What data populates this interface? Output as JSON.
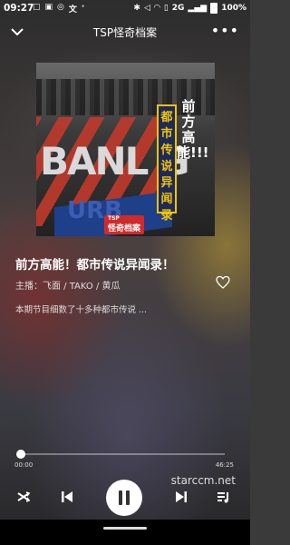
{
  "status_bar": {
    "time": "09:27",
    "battery": "100%",
    "network": "2G"
  },
  "header": {
    "title": "TSP怪奇档案"
  },
  "cover": {
    "side_text": "前方高能!!!",
    "vertical_label": "都市传说异闻录",
    "banner_text": "BANL G",
    "urban_text": "URB",
    "logo_top": "TSP",
    "logo_main": "怪奇档案"
  },
  "episode": {
    "title": "前方高能！都市传说异闻录！",
    "hosts": "主播：飞面 / TAKO / 黄瓜",
    "description": "本期节目细数了十多种都市传说 ..."
  },
  "player": {
    "current_time": "00:00",
    "total_time": "46:25",
    "progress": 0
  },
  "watermark": "starccm.net",
  "colors": {
    "accent_yellow": "#f2c400",
    "cover_red": "#c0392b",
    "cover_blue": "#1e3f8a"
  }
}
